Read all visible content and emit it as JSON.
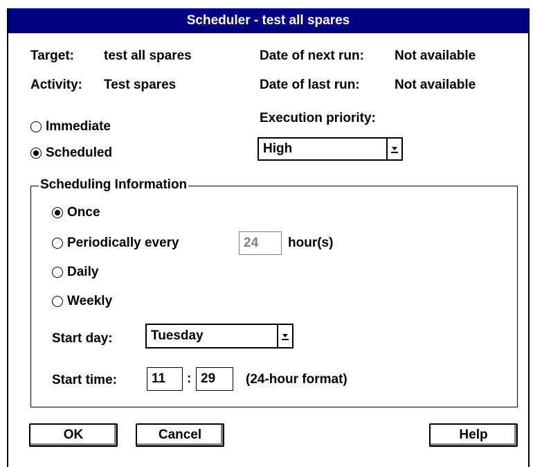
{
  "window": {
    "title": "Scheduler - test all spares"
  },
  "info": {
    "target_label": "Target:",
    "target_value": "test all spares",
    "activity_label": "Activity:",
    "activity_value": "Test spares",
    "next_run_label": "Date of next run:",
    "next_run_value": "Not available",
    "last_run_label": "Date of last run:",
    "last_run_value": "Not available"
  },
  "mode": {
    "immediate_label": "Immediate",
    "scheduled_label": "Scheduled",
    "selected": "Scheduled"
  },
  "priority": {
    "label": "Execution priority:",
    "value": "High"
  },
  "scheduling": {
    "group_label": "Scheduling Information",
    "once_label": "Once",
    "periodic_label": "Periodically every",
    "periodic_hours": "24",
    "hours_unit": "hour(s)",
    "daily_label": "Daily",
    "weekly_label": "Weekly",
    "selected": "Once",
    "start_day_label": "Start day:",
    "start_day_value": "Tuesday",
    "start_time_label": "Start time:",
    "start_hour": "11",
    "time_sep": ":",
    "start_minute": "29",
    "time_format_note": "(24-hour format)"
  },
  "buttons": {
    "ok": "OK",
    "cancel": "Cancel",
    "help": "Help"
  },
  "icons": {
    "dropdown": "dropdown-arrow-icon",
    "radio_selected": "radio-selected-icon",
    "radio_empty": "radio-empty-icon"
  },
  "colors": {
    "titlebar": "#000080",
    "titlebar_text": "#ffffff"
  }
}
